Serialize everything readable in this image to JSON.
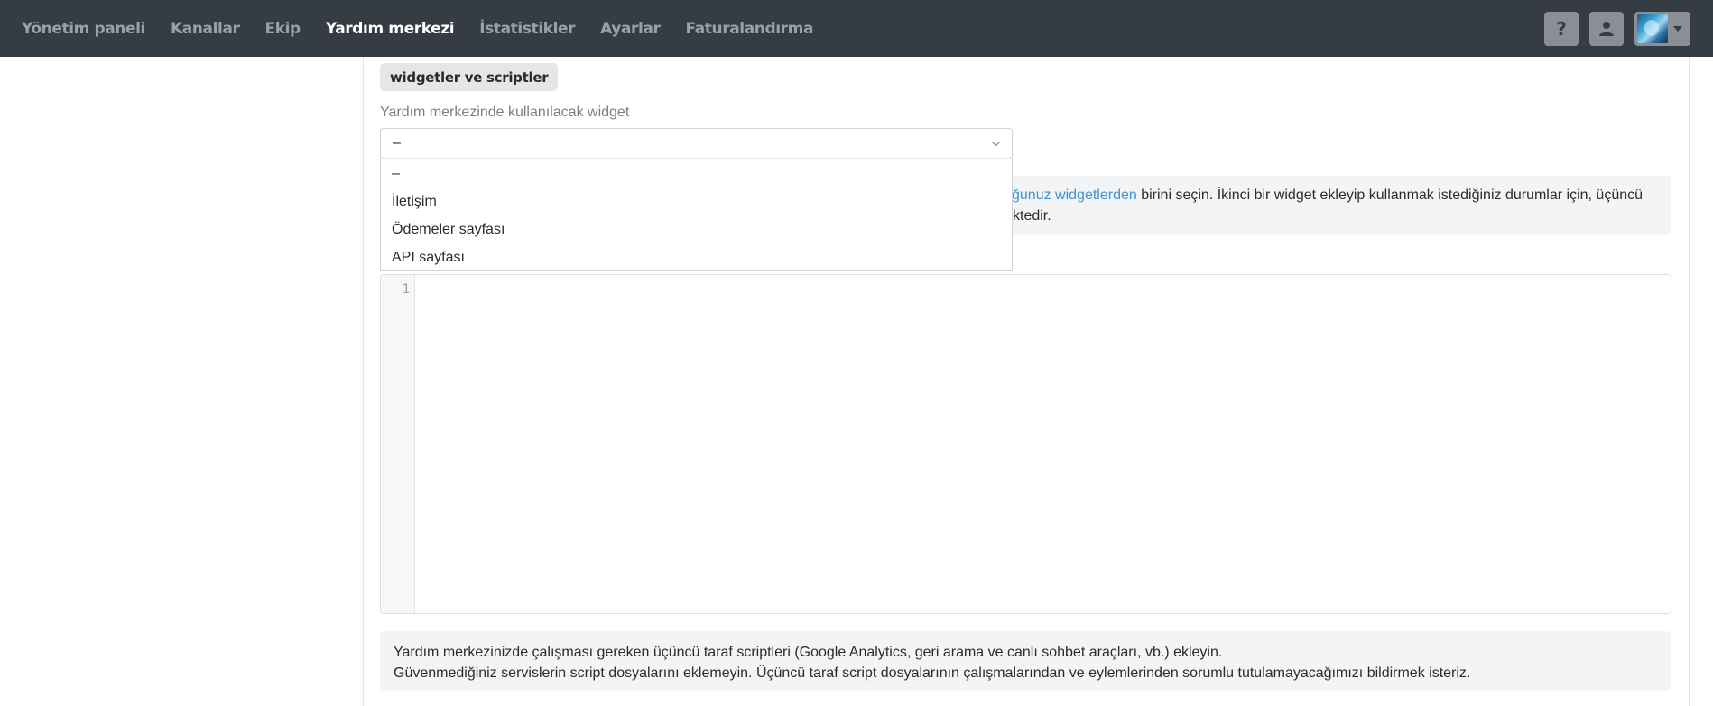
{
  "nav": {
    "items": [
      {
        "label": "Yönetim paneli",
        "active": false
      },
      {
        "label": "Kanallar",
        "active": false
      },
      {
        "label": "Ekip",
        "active": false
      },
      {
        "label": "Yardım merkezi",
        "active": true
      },
      {
        "label": "İstatistikler",
        "active": false
      },
      {
        "label": "Ayarlar",
        "active": false
      },
      {
        "label": "Faturalandırma",
        "active": false
      }
    ],
    "help_label": "?",
    "icons": {
      "help": "question-icon",
      "profile": "user-icon",
      "avatar": "avatar-image",
      "caret": "caret-down-icon"
    }
  },
  "section": {
    "badge": "widgetler ve scriptler",
    "widget_label": "Yardım merkezinde kullanılacak widget"
  },
  "select": {
    "selected": "–",
    "options": [
      "–",
      "İletişim",
      "Ödemeler sayfası",
      "API sayfası"
    ]
  },
  "info1": {
    "line1_link": "ğunuz widgetlerden",
    "line1_text": " birini seçin. İkinci bir widget ekleyip kullanmak istediğiniz durumlar için, üçüncü",
    "line2_text": "ktedir."
  },
  "editor": {
    "line_number": "1"
  },
  "info2": {
    "line1": "Yardım merkezinizde çalışması gereken üçüncü taraf scriptleri (Google Analytics, geri arama ve canlı sohbet araçları, vb.) ekleyin.",
    "line2": "Güvenmediğiniz servislerin script dosyalarını eklemeyin. Üçüncü taraf script dosyalarının çalışmalarından ve eylemlerinden sorumlu tutulamayacağımızı bildirmek isteriz."
  },
  "colors": {
    "nav_bg": "#363c44",
    "nav_inactive": "#9aa0a8",
    "nav_active": "#ffffff",
    "link": "#3e93d1",
    "info_bg": "#f3f4f5"
  }
}
